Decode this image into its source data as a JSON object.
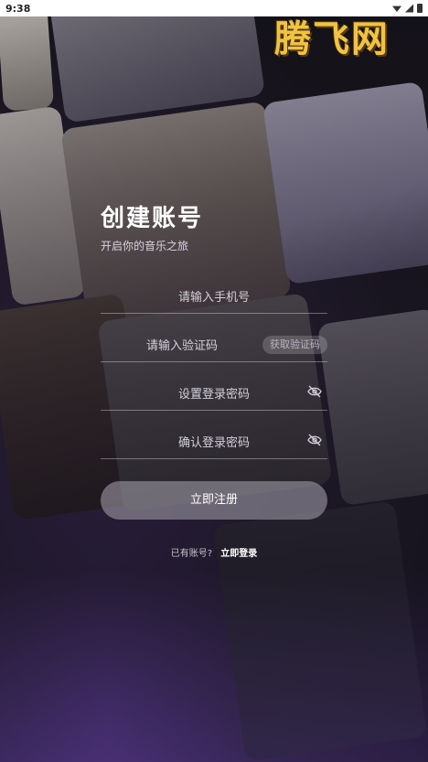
{
  "status_bar": {
    "time": "9:38"
  },
  "watermark": "腾飞网",
  "header": {
    "title": "创建账号",
    "subtitle": "开启你的音乐之旅"
  },
  "form": {
    "phone_placeholder": "请输入手机号",
    "code_placeholder": "请输入验证码",
    "get_code_label": "获取验证码",
    "password_placeholder": "设置登录密码",
    "confirm_placeholder": "确认登录密码"
  },
  "register_label": "立即注册",
  "footer": {
    "has_account": "已有账号?",
    "login_label": "立即登录"
  },
  "icons": {
    "password_toggle": "eye-off-icon",
    "confirm_toggle": "eye-off-icon"
  },
  "colors": {
    "watermark": "#f0c443",
    "accent_glow": "#5a3a8c"
  }
}
